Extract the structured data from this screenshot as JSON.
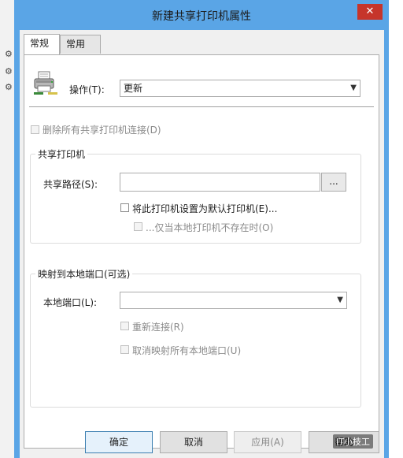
{
  "window": {
    "title": "新建共享打印机属性",
    "close_glyph": "✕"
  },
  "tabs": [
    {
      "label": "常规",
      "active": true
    },
    {
      "label": "常用",
      "active": false
    }
  ],
  "action": {
    "label": "操作(T):",
    "value": "更新"
  },
  "delete_all": {
    "label": "删除所有共享打印机连接(D)",
    "checked": false,
    "disabled": true
  },
  "shared_printer": {
    "group_title": "共享打印机",
    "path_label": "共享路径(S):",
    "path_value": "",
    "browse_label": "...",
    "set_default": {
      "label": "将此打印机设置为默认打印机(E)...",
      "checked": false
    },
    "only_if_no_local": {
      "label": "...仅当本地打印机不存在时(O)",
      "checked": false,
      "disabled": true
    }
  },
  "local_port_map": {
    "group_title": "映射到本地端口(可选)",
    "port_label": "本地端口(L):",
    "port_value": "",
    "reconnect": {
      "label": "重新连接(R)",
      "checked": false,
      "disabled": true
    },
    "unmap_all": {
      "label": "取消映射所有本地端口(U)",
      "checked": false,
      "disabled": true
    }
  },
  "buttons": {
    "ok": "确定",
    "cancel": "取消",
    "apply": "应用(A)",
    "help": "帮助"
  },
  "watermark": "IT小技工",
  "colors": {
    "title_bar": "#5aa5e6",
    "close": "#c6352b",
    "default_border": "#3c7fb1"
  }
}
